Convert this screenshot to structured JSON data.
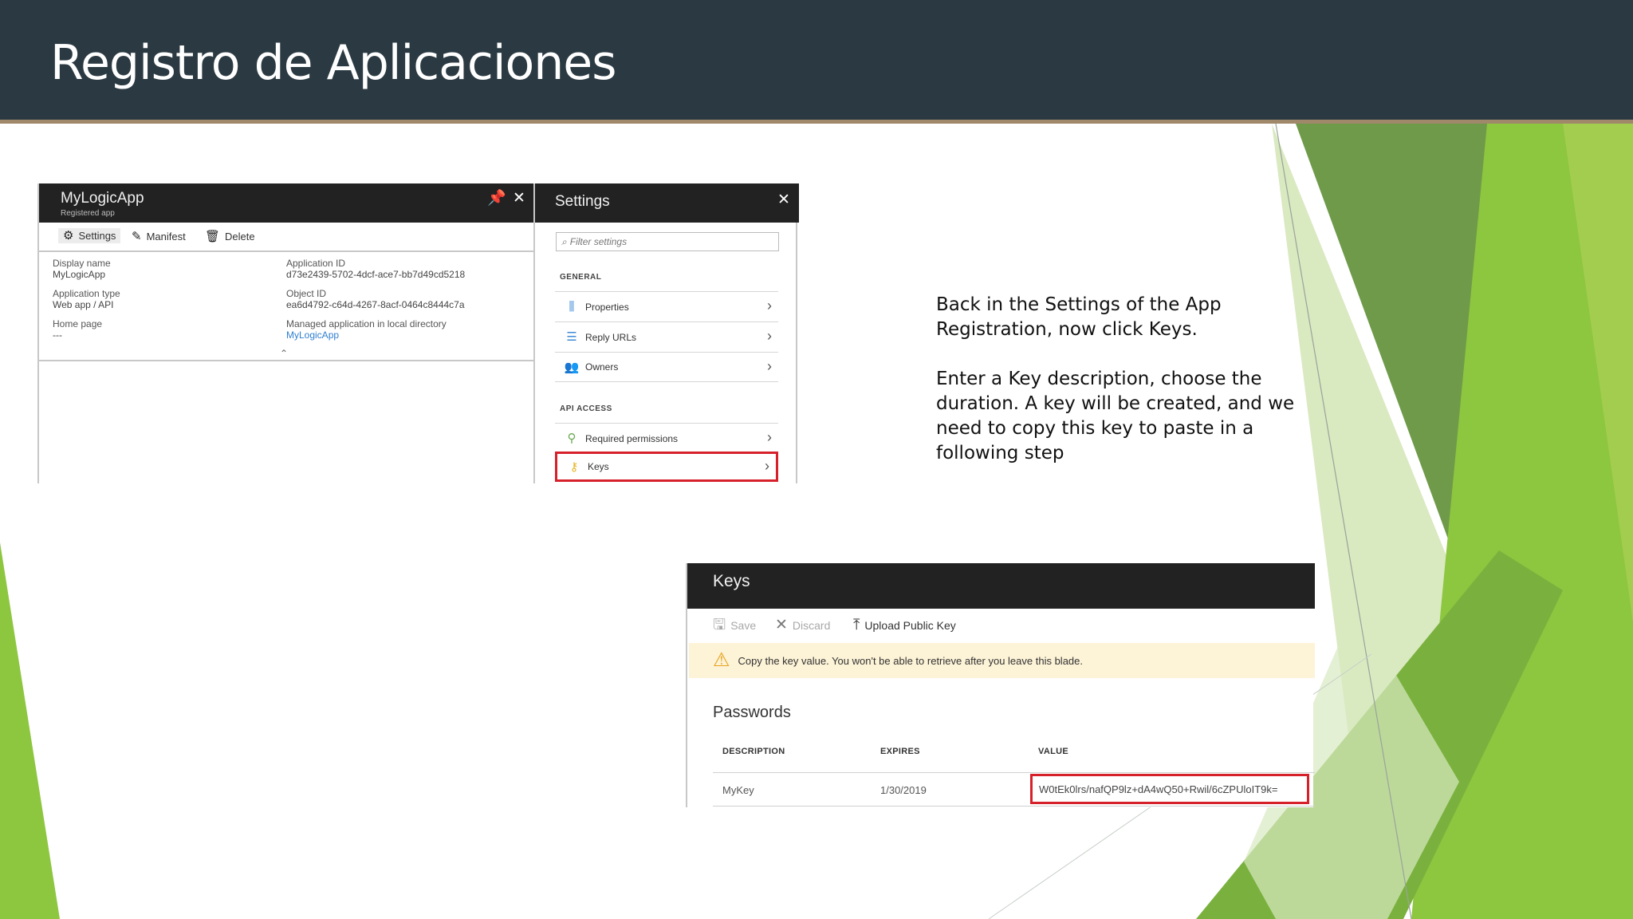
{
  "slide": {
    "title": "Registro de Aplicaciones",
    "paragraphs": [
      "Back in the Settings of the App Registration, now click Keys.",
      "Enter a Key description, choose the duration. A key will be created, and we need to copy this key to paste in a following step"
    ],
    "colors": {
      "title_bar": "#2b3a42",
      "rule": "#a0896a",
      "accent_green": "#8dc63f",
      "highlight_red": "#d6212b"
    }
  },
  "app_blade": {
    "title": "MyLogicApp",
    "subtitle": "Registered app",
    "toolbar": {
      "settings": "Settings",
      "manifest": "Manifest",
      "delete": "Delete"
    },
    "properties": {
      "display_name_label": "Display name",
      "display_name": "MyLogicApp",
      "application_type_label": "Application type",
      "application_type": "Web app / API",
      "home_page_label": "Home page",
      "home_page": "---",
      "application_id_label": "Application ID",
      "application_id": "d73e2439-5702-4dcf-ace7-bb7d49cd5218",
      "object_id_label": "Object ID",
      "object_id": "ea6d4792-c64d-4267-8acf-0464c8444c7a",
      "managed_app_label": "Managed application in local directory",
      "managed_app_link": "MyLogicApp"
    }
  },
  "settings_blade": {
    "title": "Settings",
    "filter_placeholder": "Filter settings",
    "general_label": "GENERAL",
    "api_access_label": "API ACCESS",
    "items": {
      "properties": "Properties",
      "reply_urls": "Reply URLs",
      "owners": "Owners",
      "required_permissions": "Required permissions",
      "keys": "Keys"
    }
  },
  "keys_blade": {
    "title": "Keys",
    "toolbar": {
      "save": "Save",
      "discard": "Discard",
      "upload": "Upload Public Key"
    },
    "warning": "Copy the key value. You won't be able to retrieve after you leave this blade.",
    "passwords_title": "Passwords",
    "columns": {
      "description": "DESCRIPTION",
      "expires": "EXPIRES",
      "value": "VALUE"
    },
    "row": {
      "description": "MyKey",
      "expires": "1/30/2019",
      "value": "W0tEk0lrs/nafQP9lz+dA4wQ50+Rwil/6cZPUloIT9k="
    }
  }
}
